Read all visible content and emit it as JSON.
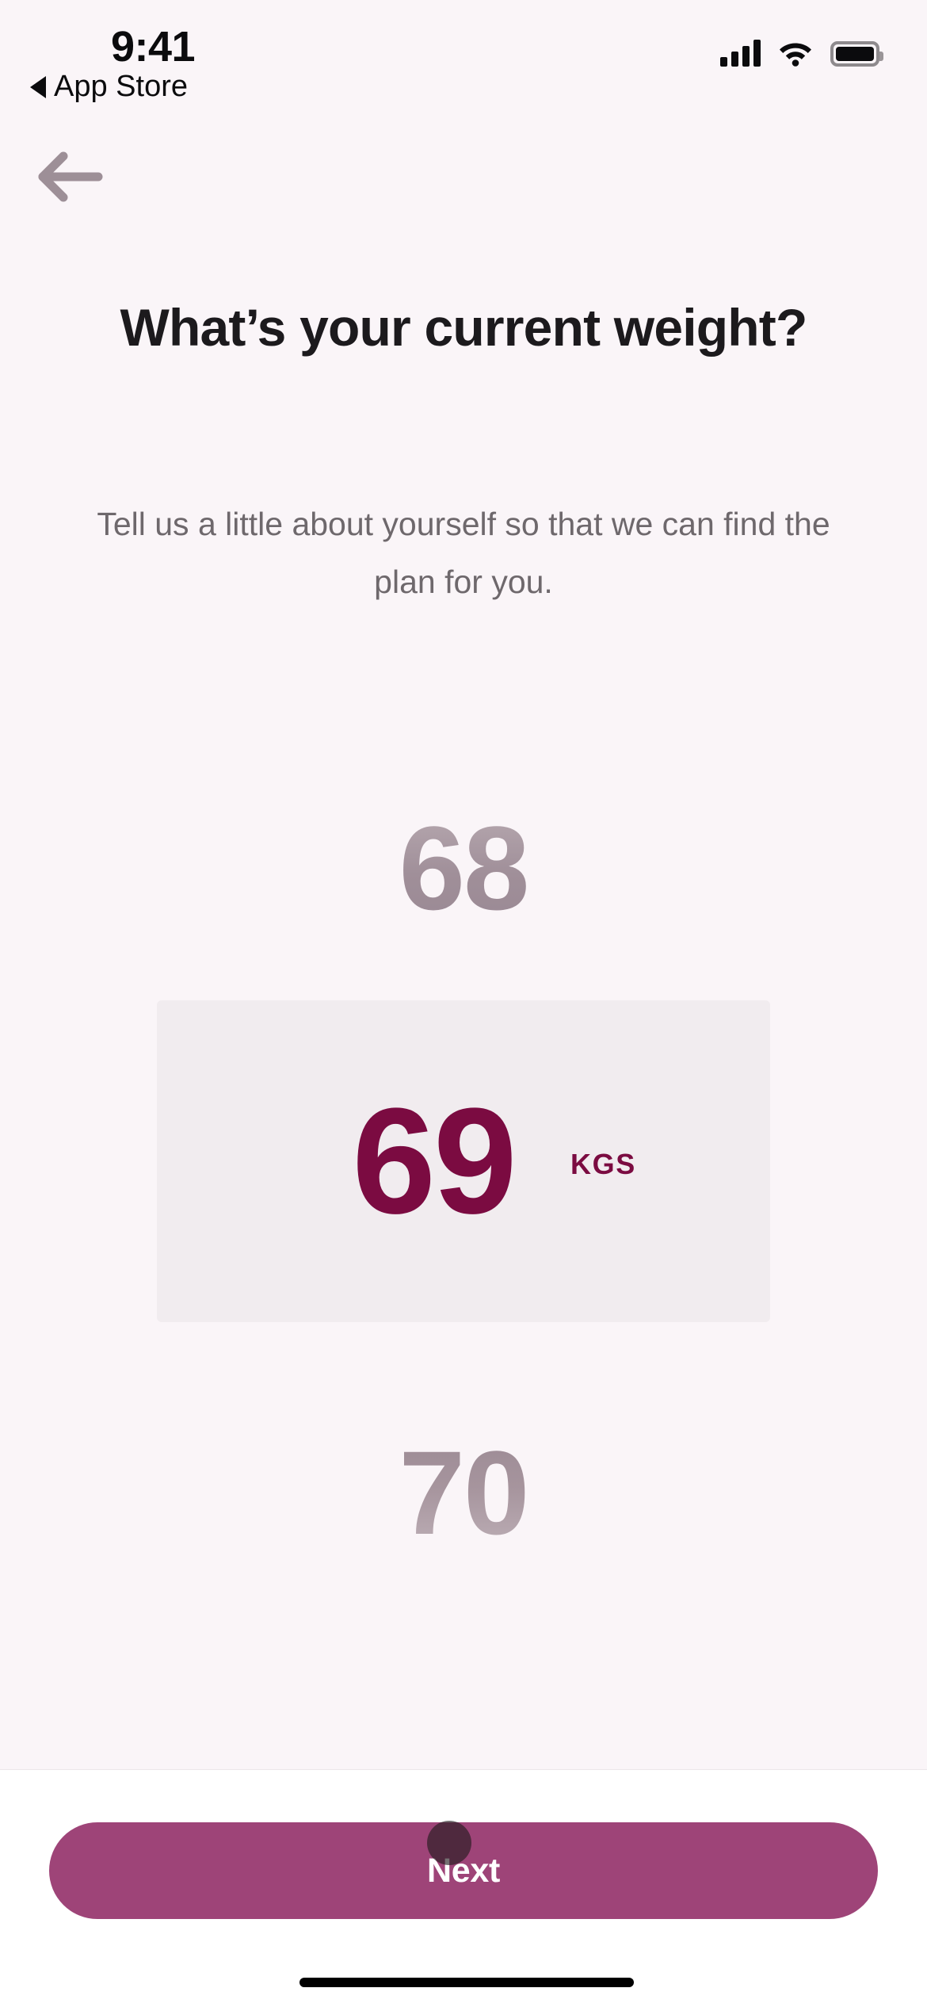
{
  "status_bar": {
    "time": "9:41",
    "back_app_label": "App Store",
    "back_triangle_icon": "triangle-left-icon",
    "signal_icon": "cellular-signal-icon",
    "wifi_icon": "wifi-icon",
    "battery_icon": "battery-full-icon"
  },
  "nav": {
    "back_icon": "arrow-left-icon"
  },
  "header": {
    "title": "What’s your current weight?",
    "subtitle": "Tell us a little about yourself so that we can find the plan for you."
  },
  "picker": {
    "previous_value": "68",
    "selected_value": "69",
    "next_value": "70",
    "unit": "KGS",
    "highlight_color": "#f1ecef",
    "selected_color": "#7b0b41",
    "dim_color": "#a3919b"
  },
  "footer": {
    "next_label": "Next",
    "next_button_color": "#9e4478",
    "home_indicator": "home-indicator"
  },
  "theme": {
    "background": "#faf5f8",
    "title_color": "#1c1a1d",
    "subtitle_color": "#6e686c",
    "accent": "#7b0b41"
  }
}
